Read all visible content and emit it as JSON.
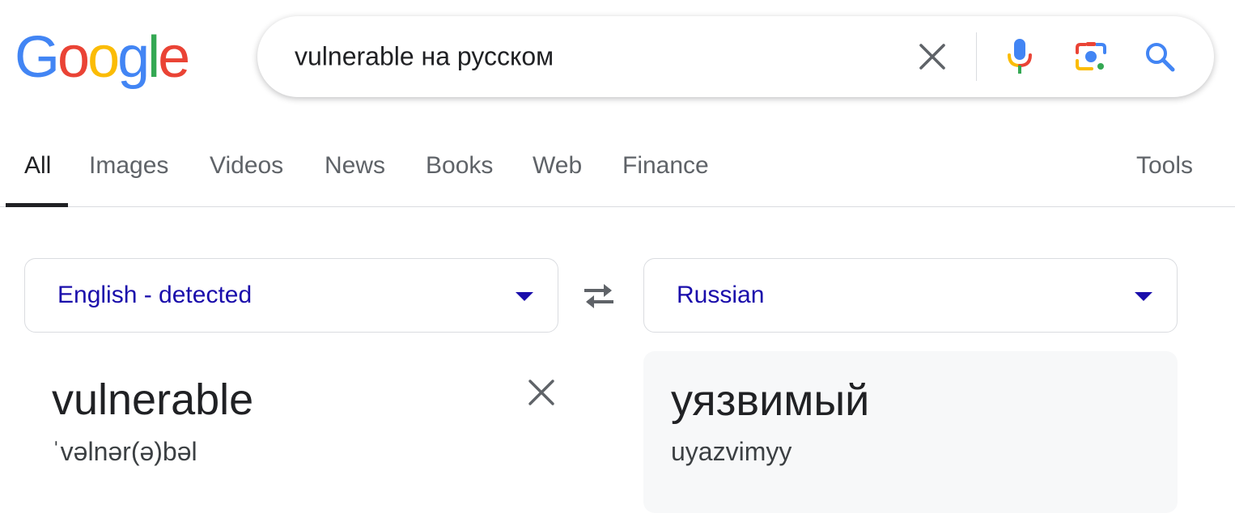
{
  "logo": {
    "text": "Google",
    "letters": [
      "G",
      "o",
      "o",
      "g",
      "l",
      "e"
    ],
    "colors": [
      "#4285F4",
      "#EA4335",
      "#FBBC05",
      "#4285F4",
      "#34A853",
      "#EA4335"
    ]
  },
  "search": {
    "query": "vulnerable на русском",
    "icons": [
      "close-icon",
      "microphone-icon",
      "lens-camera-icon",
      "search-icon"
    ]
  },
  "tabs": [
    {
      "label": "All",
      "active": true
    },
    {
      "label": "Images",
      "active": false
    },
    {
      "label": "Videos",
      "active": false
    },
    {
      "label": "News",
      "active": false
    },
    {
      "label": "Books",
      "active": false
    },
    {
      "label": "Web",
      "active": false
    },
    {
      "label": "Finance",
      "active": false
    }
  ],
  "tools_label": "Tools",
  "translator": {
    "source_language": "English - detected",
    "target_language": "Russian",
    "swap_icon": "swap-arrows-icon",
    "source_text": "vulnerable",
    "source_phonetic": "ˈvəlnər(ə)bəl",
    "target_text": "уязвимый",
    "target_transliteration": "uyazvimyy"
  },
  "colors": {
    "link_blue": "#1a0dab",
    "search_blue": "#4285F4",
    "text_primary": "#202124",
    "text_secondary": "#5f6368",
    "border": "#dadce0",
    "panel_bg": "#f7f8f9"
  }
}
